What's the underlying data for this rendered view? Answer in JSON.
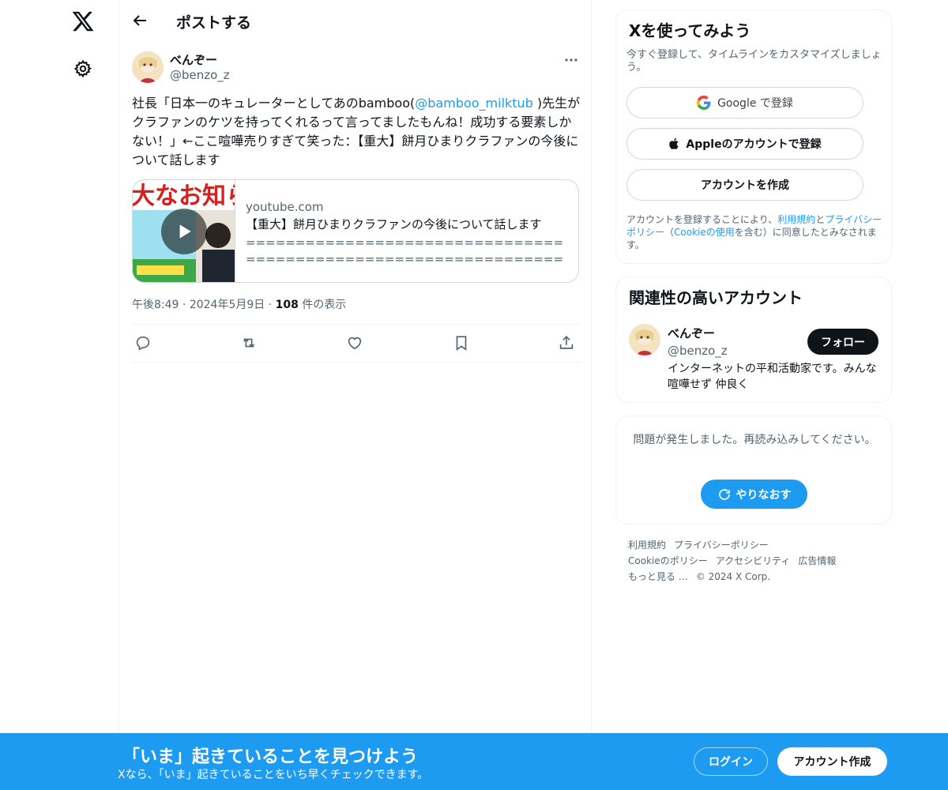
{
  "nav": {
    "logo_icon": "x-logo-icon",
    "settings_icon": "gear-icon"
  },
  "header": {
    "title": "ポストする",
    "back_icon": "arrow-left-icon"
  },
  "post": {
    "author_name": "べんぞー",
    "author_handle": "@benzo_z",
    "text_before": "社長「日本一のキュレーターとしてあのbamboo(",
    "mention": "@bamboo_milktub",
    "text_after": " )先生がクラファンのケツを持ってくれるって言ってましたもんね！成功する要素しかない！」←ここ喧嘩売りすぎて笑った：【重大】餅月ひまりクラファンの今後について話します",
    "card": {
      "domain": "youtube.com",
      "title": "【重大】餅月ひまりクラファンの今後について話します",
      "description": "====================================================================【赤月ゆにのYouTubeチャンネル】..."
    },
    "time": "午後8:49",
    "date": "2024年5月9日",
    "views_count": "108",
    "views_label": " 件の表示",
    "actions": [
      "reply-icon",
      "repost-icon",
      "like-icon",
      "bookmark-icon",
      "share-icon"
    ]
  },
  "signup_panel": {
    "title": "Xを使ってみよう",
    "subtitle": "今すぐ登録して、タイムラインをカスタマイズしましょう。",
    "google_label": "Google で登録",
    "apple_label": "Appleのアカウントで登録",
    "create_label": "アカウントを作成",
    "terms_prefix": "アカウントを登録することにより、",
    "terms_link": "利用規約",
    "terms_and": "と",
    "privacy_link": "プライバシーポリシー",
    "terms_paren_open": "（",
    "cookie_link": "Cookieの使用",
    "terms_suffix": "を含む）に同意したとみなされます。"
  },
  "related_panel": {
    "title": "関連性の高いアカウント",
    "name": "べんぞー",
    "handle": "@benzo_z",
    "follow_label": "フォロー",
    "bio": "インターネットの平和活動家です。みんな喧嘩せず 仲良く"
  },
  "error_panel": {
    "message": "問題が発生しました。再読み込みしてください。",
    "retry_label": "やりなおす"
  },
  "footer": {
    "links": [
      "利用規約",
      "プライバシーポリシー",
      "Cookieのポリシー",
      "アクセシビリティ",
      "広告情報",
      "もっと見る …",
      "© 2024 X Corp."
    ]
  },
  "bottom_bar": {
    "title": "「いま」起きていることを見つけよう",
    "subtitle": "Xなら、「いま」起きていることをいち早くチェックできます。",
    "login_label": "ログイン",
    "signup_label": "アカウント作成"
  },
  "colors": {
    "accent": "#1d9bf0",
    "text": "#0f1419",
    "secondary": "#536471",
    "border": "#eff3f4"
  }
}
